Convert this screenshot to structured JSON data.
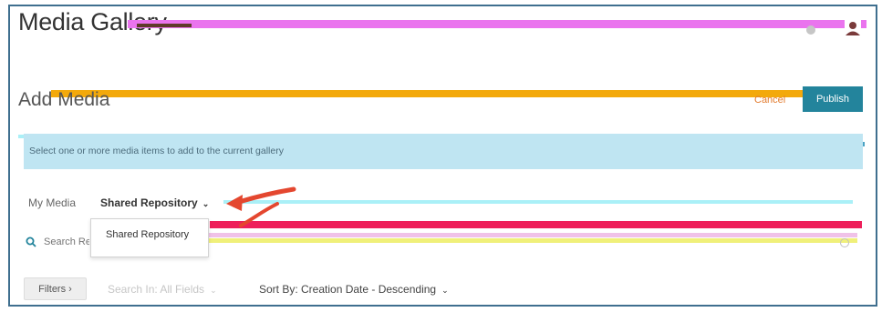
{
  "header": {
    "title": "Media Gallery"
  },
  "add_media": {
    "title": "Add Media",
    "cancel_label": "Cancel",
    "publish_label": "Publish"
  },
  "banner": {
    "text": "Select one or more media items to add to the current gallery"
  },
  "tabs": {
    "my_media": "My Media",
    "shared": "Shared Repository",
    "chevron": "⌄"
  },
  "dropdown": {
    "items": [
      "Shared Repository"
    ]
  },
  "search": {
    "placeholder": "Search Re"
  },
  "filters": {
    "button_label": "Filters  ›",
    "search_in": "Search In: All Fields",
    "sort_by": "Sort By: Creation Date - Descending"
  },
  "colors": {
    "accent": "#23849c",
    "cancel": "#e27b2f",
    "banner": "#bfe5f2",
    "frame": "#3f6f8f",
    "arrow": "#e4472f"
  }
}
